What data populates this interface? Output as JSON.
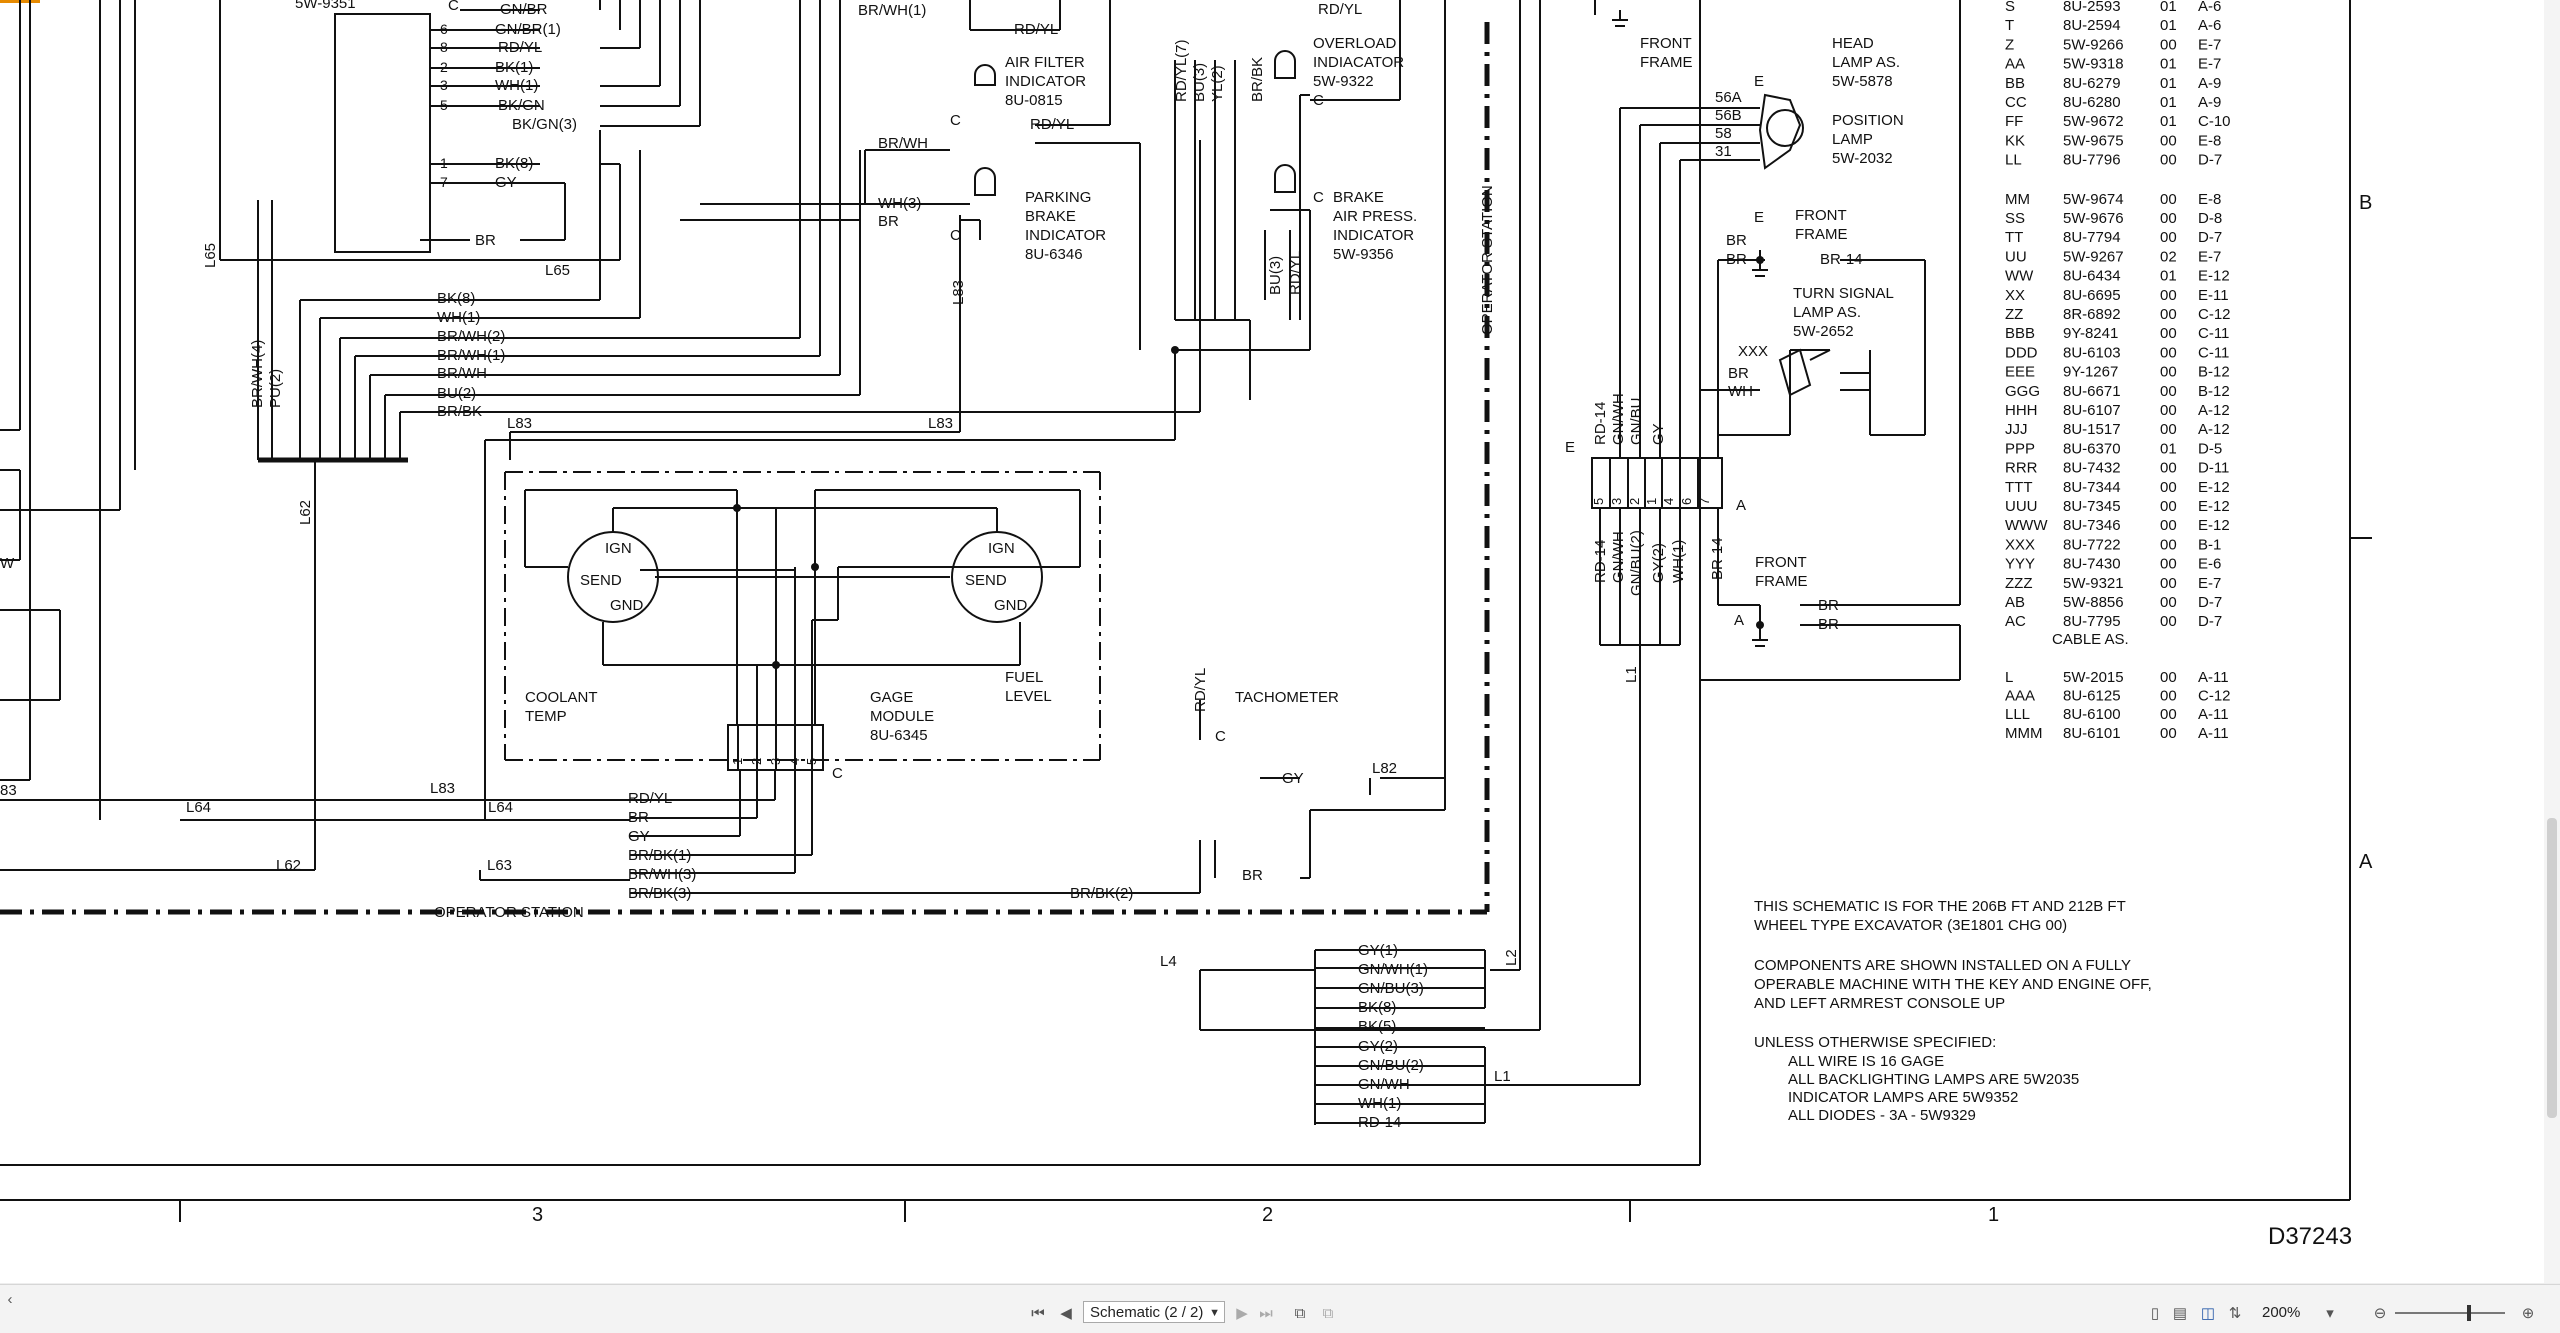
{
  "app": {
    "accent": "#e68a00"
  },
  "pager": {
    "page_label": "Schematic (2 / 2)",
    "zoom": "200%"
  },
  "sheet": {
    "drawing_number": "D37243",
    "zone_numbers": [
      "3",
      "2",
      "1"
    ],
    "zone_letters": [
      "B",
      "A"
    ],
    "boxes": {
      "operator_station": "OPERATOR STATION",
      "operator_station_bottom": "OPERATOR STATION",
      "front_frame_top": [
        "FRONT",
        "FRAME"
      ],
      "front_frame_mid": [
        "FRONT",
        "FRAME"
      ],
      "front_frame_bottom": [
        "FRONT",
        "FRAME"
      ]
    },
    "switch_part": "5W-9351",
    "switch_pins": [
      "6",
      "8",
      "2",
      "3",
      "5",
      "1",
      "7"
    ],
    "switch_wires": [
      "GN/BR",
      "GN/BR(1)",
      "RD/YL",
      "BK(1)",
      "WH(1)",
      "BK/GN",
      "BK/GN(3)",
      "BK(8)",
      "GY",
      "BR"
    ],
    "switch_c": "C",
    "wire_labels_left": [
      "BK(8)",
      "WH(1)",
      "BR/WH(2)",
      "BR/WH(1)",
      "BR/WH",
      "BU(2)",
      "BR/BK"
    ],
    "vertical_wires_left": [
      "BR/WH(4)",
      "PU(2)"
    ],
    "circuit_labels": [
      "L65",
      "L65",
      "L83",
      "L83",
      "L83",
      "L62",
      "L64",
      "L83",
      "L64",
      "L62",
      "L63",
      "L82",
      "L4",
      "L2",
      "L1",
      "L1"
    ],
    "top_wires": [
      "BR/WH(1)",
      "RD/YL",
      "RD/YL",
      "RD/YL(7)",
      "BU(3)",
      "YL(2)",
      "BR/BK",
      "RD/YL",
      "BR/WH",
      "WH(3)",
      "BR",
      "BU(3)",
      "RD/YL"
    ],
    "air_filter": {
      "title": [
        "AIR FILTER",
        "INDICATOR",
        "8U-0815"
      ],
      "c": "C"
    },
    "parking_brake": {
      "title": [
        "PARKING",
        "BRAKE",
        "INDICATOR",
        "8U-6346"
      ],
      "c": "C"
    },
    "overload": {
      "title": [
        "OVERLOAD",
        "INDIACATOR",
        "5W-9322"
      ],
      "c": "C"
    },
    "brake_air": {
      "title": [
        "BRAKE",
        "AIR PRESS.",
        "INDICATOR",
        "5W-9356"
      ],
      "c": "C"
    },
    "gage_module": {
      "coolant": [
        "COOLANT",
        "TEMP"
      ],
      "fuel": [
        "FUEL",
        "LEVEL"
      ],
      "title": [
        "GAGE",
        "MODULE",
        "8U-6345"
      ],
      "gauge_terms": [
        "IGN",
        "SEND",
        "GND"
      ],
      "pins": [
        "1",
        "2",
        "3",
        "4",
        "5"
      ],
      "c": "C",
      "wires": [
        "RD/YL",
        "BR",
        "GY",
        "BR/BK(1)",
        "BR/WH(3)",
        "BR/BK(3)",
        "BR/BK(2)"
      ]
    },
    "tachometer": {
      "title": "TACHOMETER",
      "wires": [
        "RD/YL",
        "GY",
        "BR"
      ],
      "c": "C"
    },
    "bottom_connector": {
      "wires": [
        "GY(1)",
        "GN/WH(1)",
        "GN/BU(3)",
        "BK(8)",
        "BK(5)",
        "GY(2)",
        "GN/BU(2)",
        "GN/WH",
        "WH(1)",
        "RD-14"
      ]
    },
    "head_lamp": {
      "title": [
        "HEAD",
        "LAMP AS.",
        "5W-5878"
      ],
      "e": "E",
      "pins": [
        "56A",
        "56B",
        "58",
        "31"
      ]
    },
    "position_lamp": {
      "title": [
        "POSITION",
        "LAMP",
        "5W-2032"
      ]
    },
    "turn_signal": {
      "title": [
        "TURN SIGNAL",
        "LAMP AS.",
        "5W-2652"
      ],
      "wires": [
        "BR",
        "BR",
        "BR-14",
        "XXX",
        "BR",
        "WH"
      ],
      "e": "E"
    },
    "front_connector": {
      "wires_top": [
        "RD-14",
        "GN/WH",
        "GN/BU",
        "GY"
      ],
      "pins": [
        "5",
        "3",
        "2",
        "1",
        "4",
        "6",
        "7"
      ],
      "wires_bottom": [
        "RD-14",
        "GN/WH",
        "GN/BU(2)",
        "GY(2)",
        "WH(1)",
        "BR-14"
      ],
      "e": "E",
      "a": "A"
    },
    "ground_bottom": {
      "wires": [
        "BR",
        "BR"
      ],
      "a": "A"
    },
    "parts_table": [
      [
        "S",
        "8U-2593",
        "01",
        "A-6"
      ],
      [
        "T",
        "8U-2594",
        "01",
        "A-6"
      ],
      [
        "Z",
        "5W-9266",
        "00",
        "E-7"
      ],
      [
        "AA",
        "5W-9318",
        "01",
        "E-7"
      ],
      [
        "BB",
        "8U-6279",
        "01",
        "A-9"
      ],
      [
        "CC",
        "8U-6280",
        "01",
        "A-9"
      ],
      [
        "FF",
        "5W-9672",
        "01",
        "C-10"
      ],
      [
        "KK",
        "5W-9675",
        "00",
        "E-8"
      ],
      [
        "LL",
        "8U-7796",
        "00",
        "D-7"
      ],
      [
        "MM",
        "5W-9674",
        "00",
        "E-8"
      ],
      [
        "SS",
        "5W-9676",
        "00",
        "D-8"
      ],
      [
        "TT",
        "8U-7794",
        "00",
        "D-7"
      ],
      [
        "UU",
        "5W-9267",
        "02",
        "E-7"
      ],
      [
        "WW",
        "8U-6434",
        "01",
        "E-12"
      ],
      [
        "XX",
        "8U-6695",
        "00",
        "E-11"
      ],
      [
        "ZZ",
        "8R-6892",
        "00",
        "C-12"
      ],
      [
        "BBB",
        "9Y-8241",
        "00",
        "C-11"
      ],
      [
        "DDD",
        "8U-6103",
        "00",
        "C-11"
      ],
      [
        "EEE",
        "9Y-1267",
        "00",
        "B-12"
      ],
      [
        "GGG",
        "8U-6671",
        "00",
        "B-12"
      ],
      [
        "HHH",
        "8U-6107",
        "00",
        "A-12"
      ],
      [
        "JJJ",
        "8U-1517",
        "00",
        "A-12"
      ],
      [
        "PPP",
        "8U-6370",
        "01",
        "D-5"
      ],
      [
        "RRR",
        "8U-7432",
        "00",
        "D-11"
      ],
      [
        "TTT",
        "8U-7344",
        "00",
        "E-12"
      ],
      [
        "UUU",
        "8U-7345",
        "00",
        "E-12"
      ],
      [
        "WWW",
        "8U-7346",
        "00",
        "E-12"
      ],
      [
        "XXX",
        "8U-7722",
        "00",
        "B-1"
      ],
      [
        "YYY",
        "8U-7430",
        "00",
        "E-6"
      ],
      [
        "ZZZ",
        "5W-9321",
        "00",
        "E-7"
      ],
      [
        "AB",
        "5W-8856",
        "00",
        "D-7"
      ],
      [
        "AC",
        "8U-7795",
        "00",
        "D-7"
      ]
    ],
    "cable_label": "CABLE AS.",
    "cable_table": [
      [
        "L",
        "5W-2015",
        "00",
        "A-11"
      ],
      [
        "AAA",
        "8U-6125",
        "00",
        "C-12"
      ],
      [
        "LLL",
        "8U-6100",
        "00",
        "A-11"
      ],
      [
        "MMM",
        "8U-6101",
        "00",
        "A-11"
      ]
    ],
    "notes": [
      "THIS SCHEMATIC IS FOR THE 206B FT AND 212B FT",
      "WHEEL TYPE EXCAVATOR (3E1801 CHG 00)",
      "COMPONENTS ARE SHOWN INSTALLED ON A FULLY",
      "OPERABLE MACHINE WITH THE KEY AND ENGINE OFF,",
      "AND LEFT ARMREST CONSOLE UP",
      "UNLESS OTHERWISE SPECIFIED:",
      "ALL WIRE IS 16 GAGE",
      "ALL BACKLIGHTING LAMPS ARE 5W2035",
      "INDICATOR LAMPS ARE 5W9352",
      "ALL DIODES - 3A - 5W9329"
    ],
    "edge_labels": [
      "W",
      "83"
    ]
  }
}
